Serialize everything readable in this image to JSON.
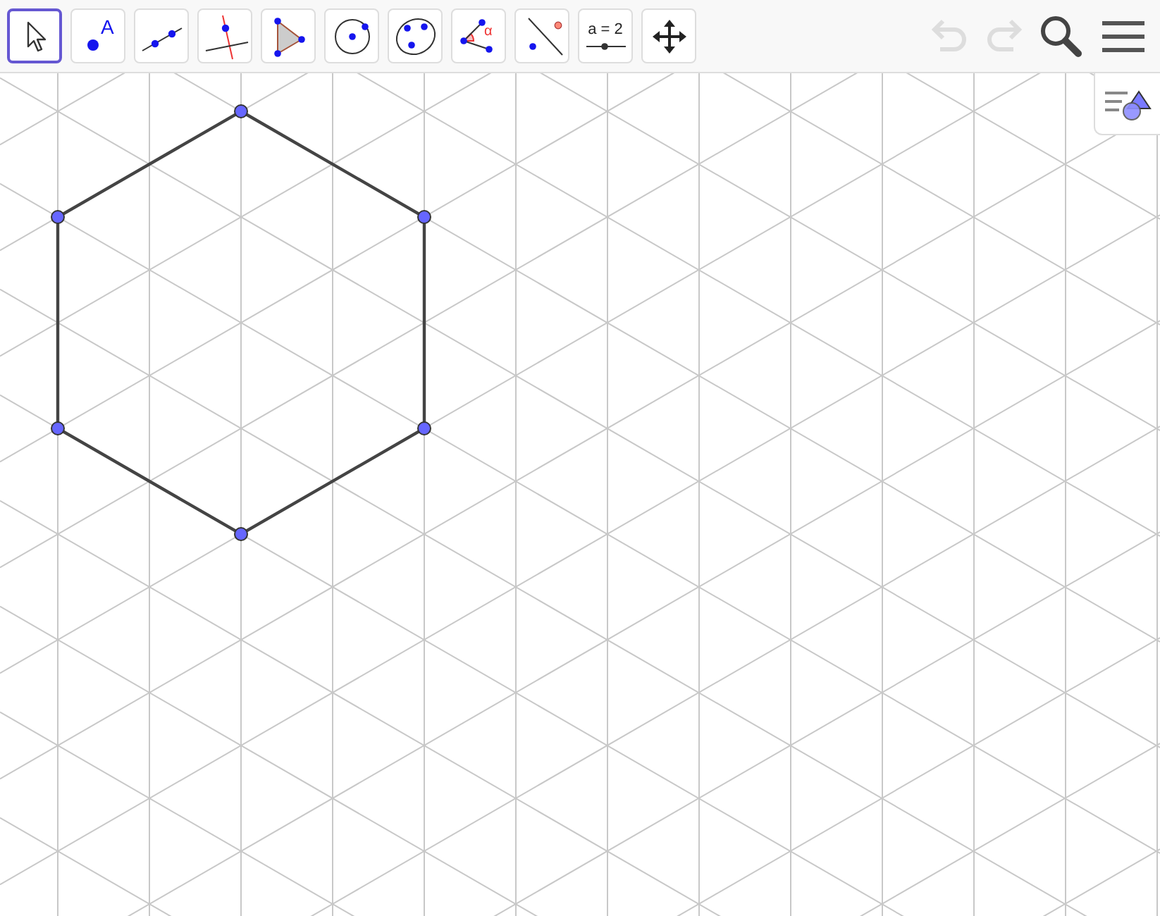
{
  "toolbar": {
    "tools": [
      {
        "kind": "move",
        "selected": true
      },
      {
        "kind": "point",
        "selected": false,
        "label": "A"
      },
      {
        "kind": "line",
        "selected": false
      },
      {
        "kind": "perpendicular",
        "selected": false
      },
      {
        "kind": "polygon",
        "selected": false
      },
      {
        "kind": "circle",
        "selected": false
      },
      {
        "kind": "conic",
        "selected": false
      },
      {
        "kind": "angle",
        "selected": false,
        "label": "α"
      },
      {
        "kind": "reflect",
        "selected": false
      },
      {
        "kind": "slider",
        "selected": false,
        "label": "a = 2"
      },
      {
        "kind": "move-view",
        "selected": false
      }
    ],
    "undo": {
      "disabled": true
    },
    "redo": {
      "disabled": true
    }
  }
}
